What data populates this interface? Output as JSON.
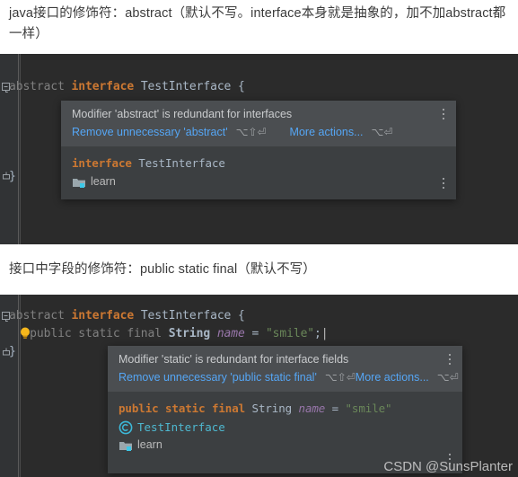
{
  "article": {
    "paragraph_1": "java接口的修饰符：abstract（默认不写。interface本身就是抽象的，加不加abstract都一样）",
    "paragraph_2": "接口中字段的修饰符：public static final（默认不写）"
  },
  "editor_1": {
    "name": "code-editor-abstract-interface",
    "lines": [
      {
        "fold": "collapse-minus",
        "tokens": [
          {
            "text": "abstract ",
            "style": "dim"
          },
          {
            "text": "interface",
            "style": "kw"
          },
          {
            "text": " TestInterface ",
            "style": "cls"
          },
          {
            "text": "{",
            "style": "punc"
          }
        ]
      },
      {
        "fold": "collapse-end",
        "tokens": [
          {
            "text": "}",
            "style": "punc"
          }
        ]
      }
    ]
  },
  "editor_2": {
    "name": "code-editor-static-field",
    "lines": [
      {
        "fold": "collapse-minus",
        "tokens": [
          {
            "text": "abstract ",
            "style": "dim"
          },
          {
            "text": "interface",
            "style": "kw"
          },
          {
            "text": " TestInterface ",
            "style": "cls"
          },
          {
            "text": "{",
            "style": "punc"
          }
        ]
      },
      {
        "bulb": true,
        "tokens": [
          {
            "text": "   public static final ",
            "style": "dim"
          },
          {
            "text": "String",
            "style": "type-b"
          },
          {
            "text": " ",
            "style": "punc"
          },
          {
            "text": "name",
            "style": "field"
          },
          {
            "text": " = ",
            "style": "punc"
          },
          {
            "text": "\"smile\"",
            "style": "str"
          },
          {
            "text": ";",
            "style": "punc"
          },
          {
            "text": "|",
            "style": "caret"
          }
        ]
      },
      {
        "fold": "collapse-end",
        "tokens": [
          {
            "text": "}",
            "style": "punc"
          }
        ]
      }
    ]
  },
  "popup_1": {
    "name": "intention-popup-abstract",
    "title": "Modifier 'abstract' is redundant for interfaces",
    "primary_action": "Remove unnecessary 'abstract'",
    "primary_shortcut": "⌥⇧⏎",
    "secondary_action": "More actions...",
    "secondary_shortcut": "⌥⏎",
    "preview": {
      "code_tokens": [
        {
          "text": "interface",
          "style": "kw"
        },
        {
          "text": " TestInterface",
          "style": "cls"
        }
      ],
      "breadcrumbs": [
        {
          "icon": "package-folder-icon",
          "label": "learn",
          "kind": "package"
        }
      ]
    },
    "kebab_icon": "more-options-icon"
  },
  "popup_2": {
    "name": "intention-popup-static",
    "title": "Modifier 'static' is redundant for interface fields",
    "primary_action": "Remove unnecessary 'public static final'",
    "primary_shortcut": "⌥⇧⏎",
    "secondary_action": "More actions...",
    "secondary_shortcut": "⌥⏎",
    "preview": {
      "code_tokens": [
        {
          "text": "public static final",
          "style": "kw"
        },
        {
          "text": " String",
          "style": "cls"
        },
        {
          "text": " ",
          "style": "punc"
        },
        {
          "text": "name",
          "style": "field"
        },
        {
          "text": " = ",
          "style": "punc"
        },
        {
          "text": "\"smile\"",
          "style": "str"
        }
      ],
      "breadcrumbs": [
        {
          "icon": "interface-class-icon",
          "label": "TestInterface",
          "kind": "interface"
        },
        {
          "icon": "package-folder-icon",
          "label": "learn",
          "kind": "package"
        }
      ]
    },
    "kebab_icon": "more-options-icon"
  },
  "watermark": "CSDN @SunsPlanter",
  "colors": {
    "editor_background": "#2b2b2b",
    "gutter_background": "#313335",
    "popup_header": "#4b4e51",
    "popup_body": "#3c3f41",
    "link": "#55a6f5",
    "keyword": "#cc7832",
    "string": "#6a8759",
    "field": "#9876aa",
    "interface_icon": "#4eb8d0",
    "identifier": "#a9b7c6",
    "redundant_dim": "#808080",
    "page_text": "#3b3b3b"
  }
}
